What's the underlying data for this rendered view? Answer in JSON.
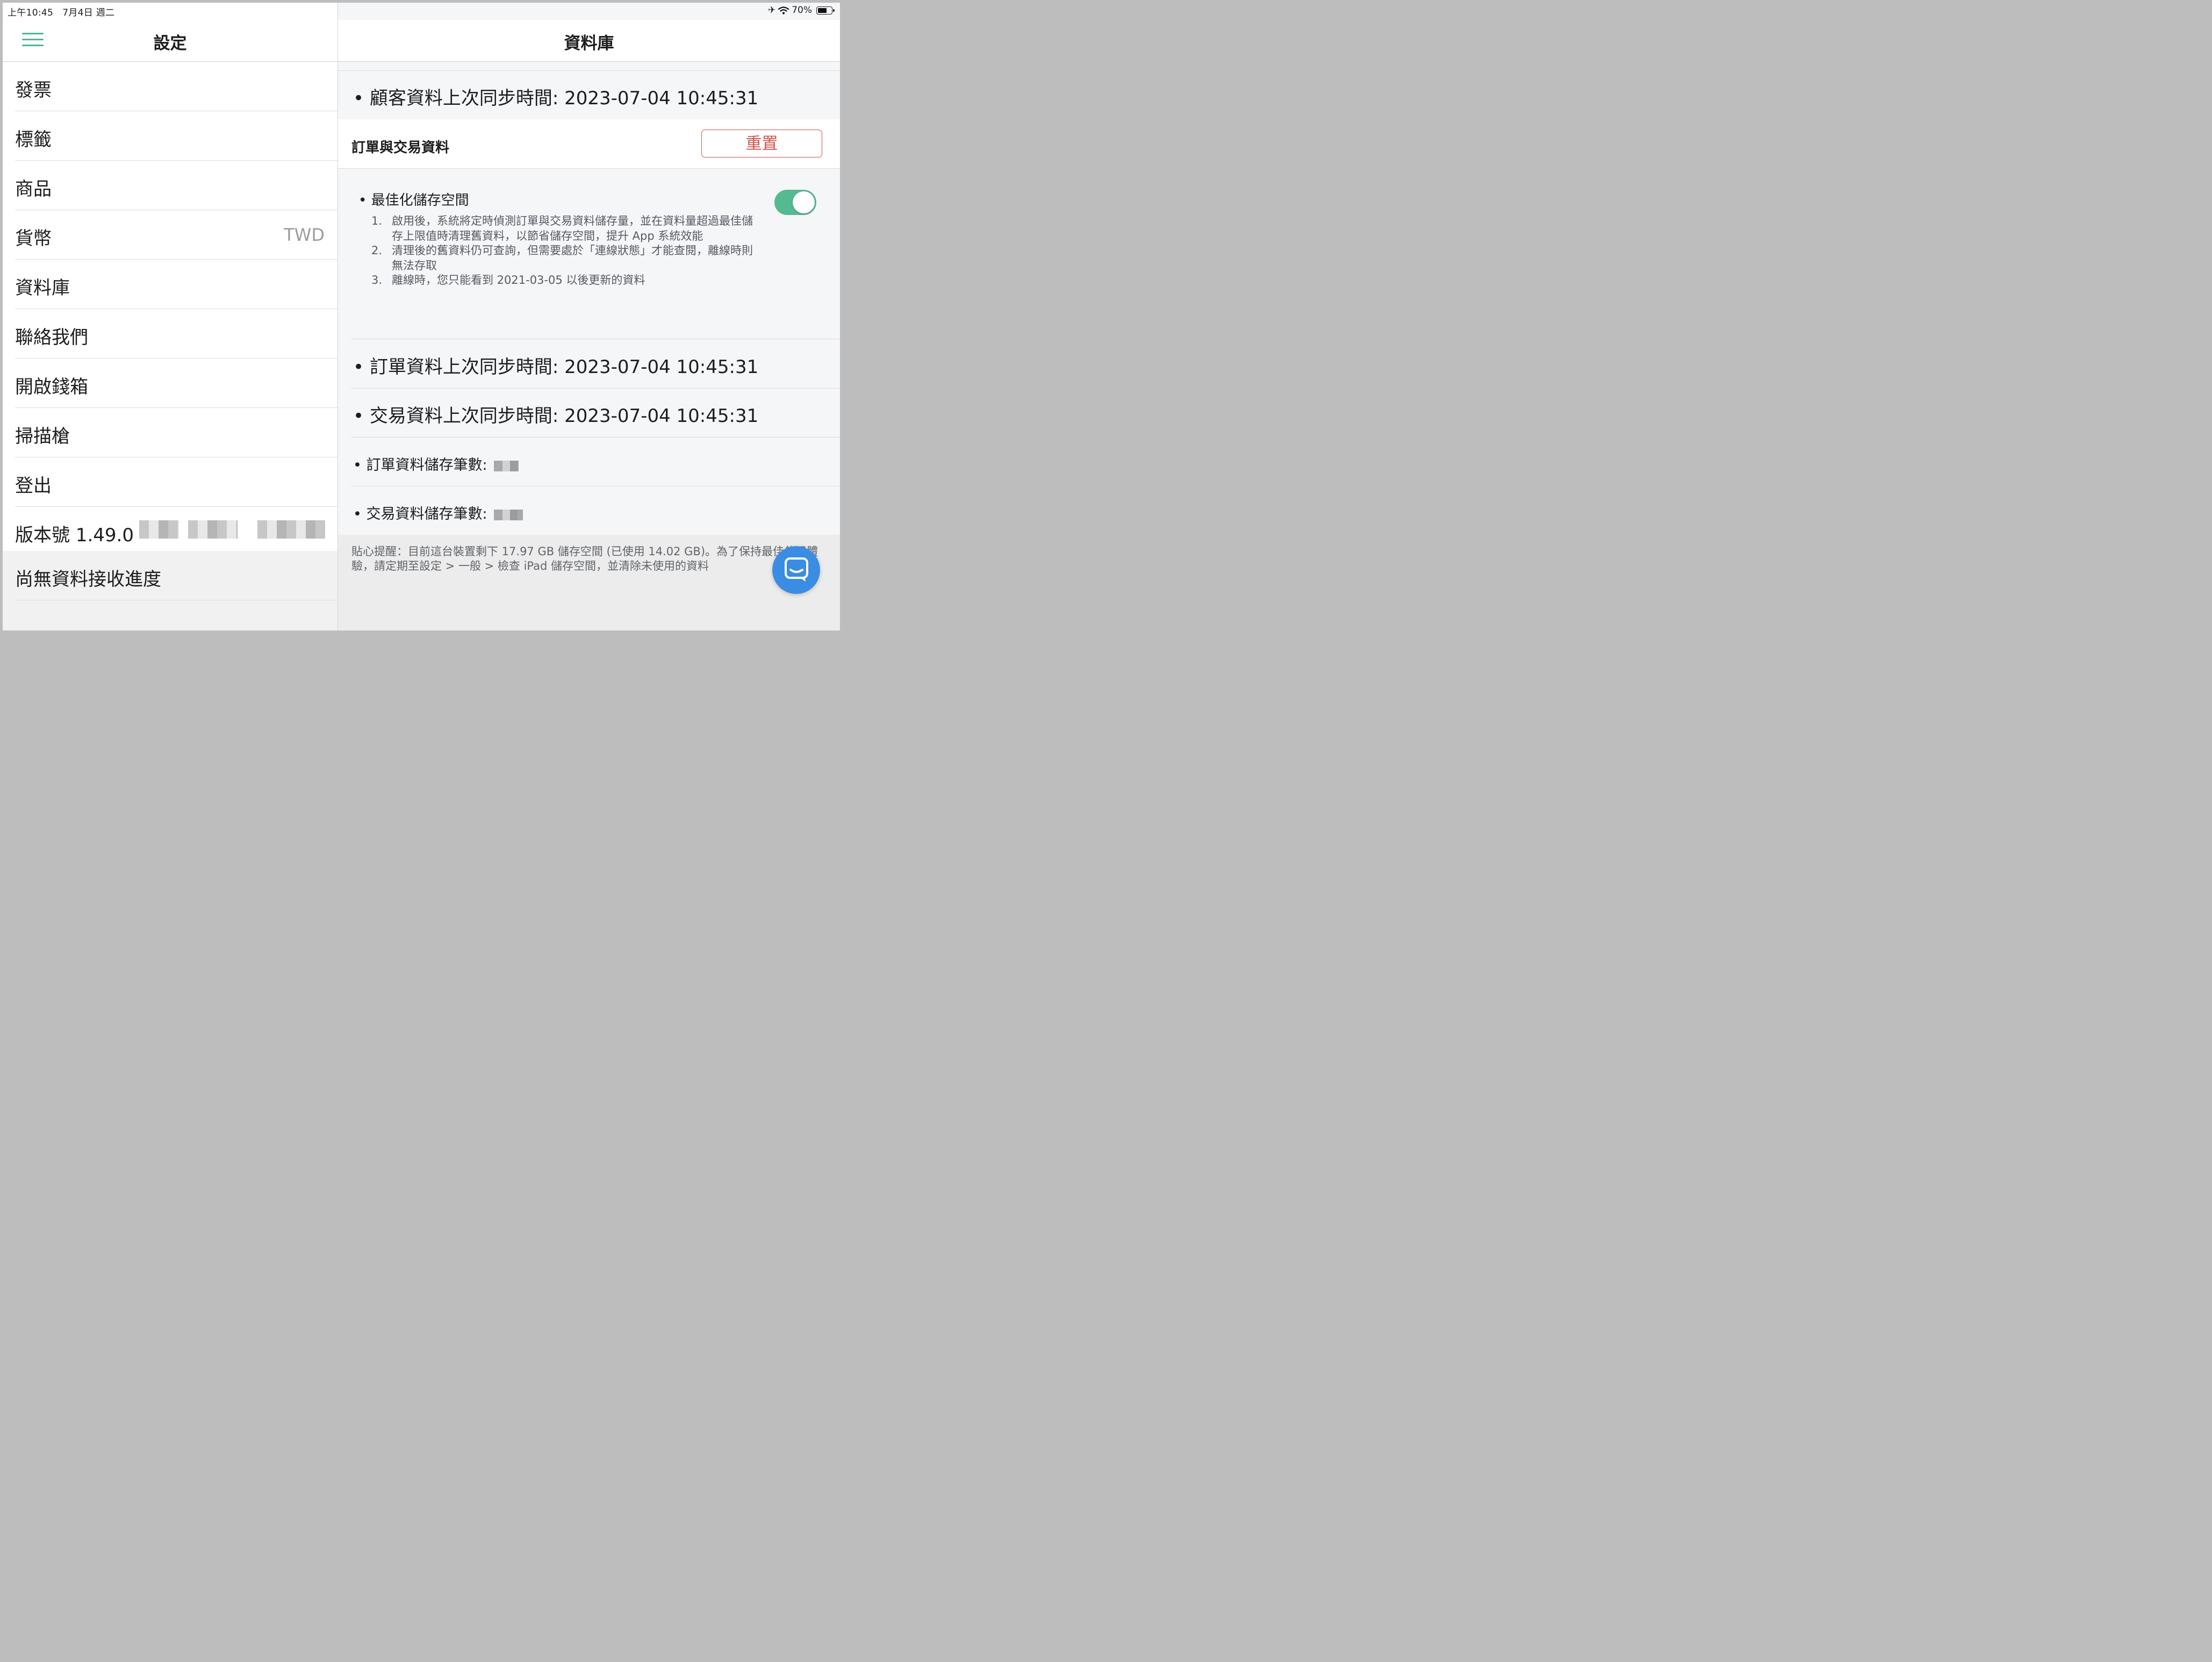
{
  "status_bar": {
    "time": "上午10:45",
    "date": "7月4日 週二",
    "battery": "70%",
    "icons": [
      "airplane-icon",
      "wifi-icon",
      "battery-icon"
    ]
  },
  "left": {
    "title": "設定",
    "items": [
      {
        "label": "發票"
      },
      {
        "label": "標籤"
      },
      {
        "label": "商品"
      },
      {
        "label": "貨幣",
        "value": "TWD"
      },
      {
        "label": "資料庫"
      },
      {
        "label": "聯絡我們"
      },
      {
        "label": "開啟錢箱"
      },
      {
        "label": "掃描槍"
      },
      {
        "label": "登出"
      },
      {
        "label": "版本號 1.49.0"
      }
    ],
    "progress": "尚無資料接收進度"
  },
  "right": {
    "title": "資料庫",
    "customer_sync": "顧客資料上次同步時間: 2023-07-04 10:45:31",
    "section_title": "訂單與交易資料",
    "reset_label": "重置",
    "optimize": {
      "title": "最佳化儲存空間",
      "enabled": true,
      "items": [
        {
          "num": "1.",
          "text": "啟用後，系統將定時偵測訂單與交易資料儲存量，並在資料量超過最佳儲存上限值時清理舊資料，以節省儲存空間，提升 App 系統效能"
        },
        {
          "num": "2.",
          "text": "清理後的舊資料仍可查詢，但需要處於「連線狀態」才能查閱，離線時則無法存取"
        },
        {
          "num": "3.",
          "text": "離線時，您只能看到 2021-03-05 以後更新的資料"
        }
      ]
    },
    "order_sync": "訂單資料上次同步時間: 2023-07-04 10:45:31",
    "transaction_sync": "交易資料上次同步時間: 2023-07-04 10:45:31",
    "order_count_label": "訂單資料儲存筆數:",
    "transaction_count_label": "交易資料儲存筆數:",
    "footer_note": "貼心提醒：目前這台裝置剩下 17.97 GB 儲存空間 (已使用 14.02 GB)。為了保持最佳使用體驗，請定期至設定 > 一般 > 檢查 iPad 儲存空間，並清除未使用的資料"
  },
  "colors": {
    "accent_green": "#55b992",
    "reset_red": "#c9574c",
    "chat_blue": "#3b8de3"
  }
}
